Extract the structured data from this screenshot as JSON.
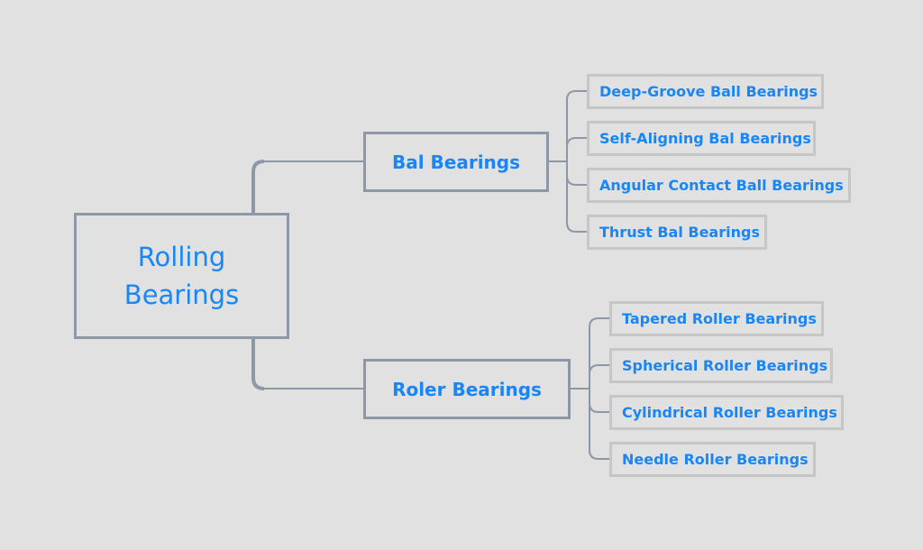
{
  "diagram": {
    "type": "mind-map",
    "colors": {
      "background": "#e1e1e1",
      "text": "#1a86f5",
      "main_border": "#8e97a6",
      "leaf_border": "#c6c6c6",
      "connector": "#8e97a6"
    },
    "root": {
      "line1": "Rolling",
      "line2": "Bearings"
    },
    "branches": [
      {
        "label": "Bal Bearings",
        "children": [
          {
            "label": "Deep-Groove Ball Bearings"
          },
          {
            "label": "Self-Aligning Bal Bearings"
          },
          {
            "label": "Angular Contact Ball Bearings"
          },
          {
            "label": "Thrust Bal Bearings"
          }
        ]
      },
      {
        "label": "Roler Bearings",
        "children": [
          {
            "label": "Tapered Roller Bearings"
          },
          {
            "label": "Spherical Roller Bearings"
          },
          {
            "label": "Cylindrical Roller Bearings"
          },
          {
            "label": "Needle Roller Bearings"
          }
        ]
      }
    ]
  }
}
